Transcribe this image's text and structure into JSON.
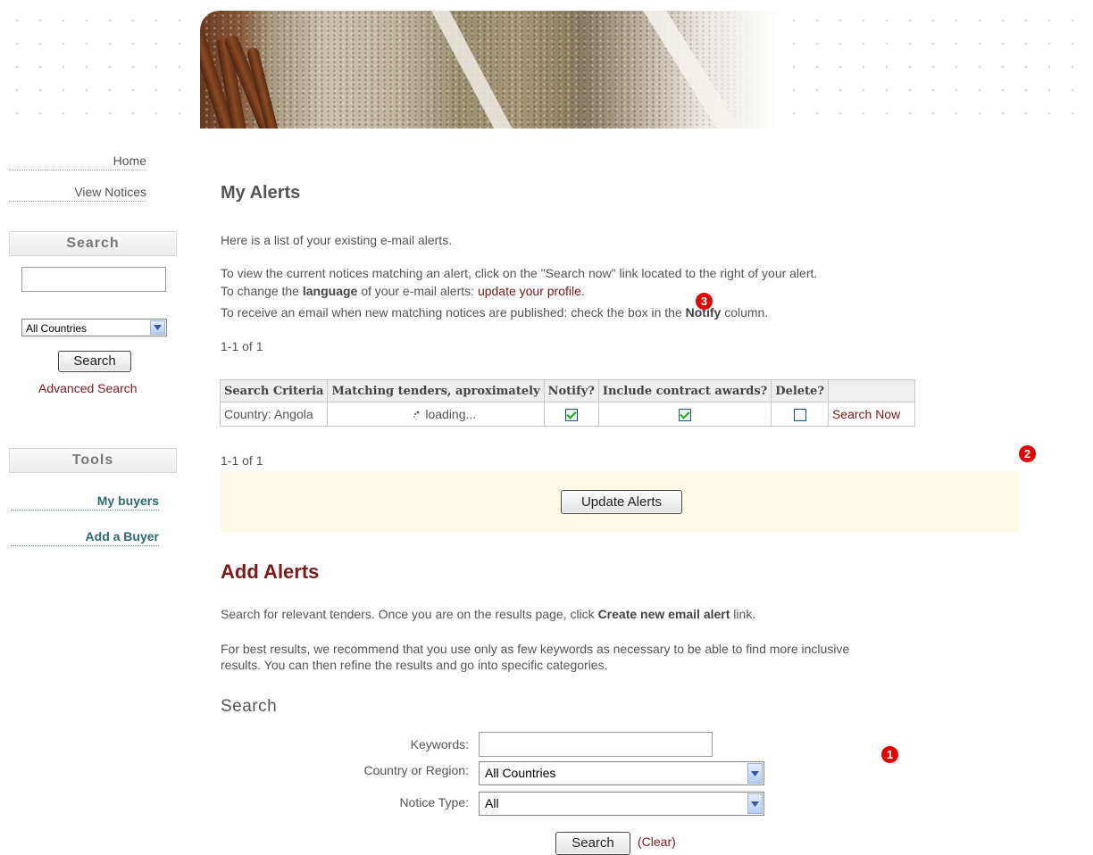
{
  "nav": {
    "home": "Home",
    "view_notices": "View Notices"
  },
  "sidebar": {
    "search_title": "Search",
    "country_select": "All Countries",
    "search_button": "Search",
    "advanced_search": "Advanced Search",
    "tools_title": "Tools",
    "my_buyers": "My buyers",
    "add_buyer": "Add a Buyer"
  },
  "main": {
    "title": "My Alerts",
    "intro": "Here is a list of your existing e-mail alerts.",
    "line1": "To view the current notices matching an alert, click on the \"Search now\" link located to the right of your alert.",
    "line2_prefix": "To change the ",
    "line2_bold": "language",
    "line2_mid": " of your e-mail alerts: ",
    "line2_link": "update your profile",
    "line2_suffix": ".",
    "line3_prefix": "To receive an email when new matching notices are published: check the box in the ",
    "line3_bold": "Notify",
    "line3_suffix": " column.",
    "count_top": "1-1 of 1",
    "count_bottom": "1-1 of 1",
    "update_button": "Update Alerts"
  },
  "table": {
    "headers": [
      "Search Criteria",
      "Matching tenders, aproximately",
      "Notify?",
      "Include contract awards?",
      "Delete?",
      ""
    ],
    "row": {
      "criteria": "Country:  Angola",
      "matching": "loading...",
      "notify": true,
      "include_awards": true,
      "delete": false,
      "action": "Search Now"
    }
  },
  "add": {
    "title": "Add Alerts",
    "p1_prefix": "Search for relevant tenders. Once you are on the results page, click ",
    "p1_bold": "Create new email alert",
    "p1_suffix": " link.",
    "p2a": "For best results, we recommend that you use only as few keywords as necessary to be able to find more inclusive",
    "p2b": "results. You can then refine the results and go into specific categories.",
    "search_title": "Search",
    "keywords_label": "Keywords:",
    "country_label": "Country or Region:",
    "country_value": "All Countries",
    "notice_label": "Notice Type:",
    "notice_value": "All",
    "search_button": "Search",
    "clear_link": "(Clear)"
  },
  "markers": [
    "1",
    "2",
    "3"
  ],
  "colors": {
    "accent": "#7a1a1a",
    "teal_link": "#2b6b6b",
    "marker": "#e00000",
    "panel": "#fdfbe6"
  }
}
